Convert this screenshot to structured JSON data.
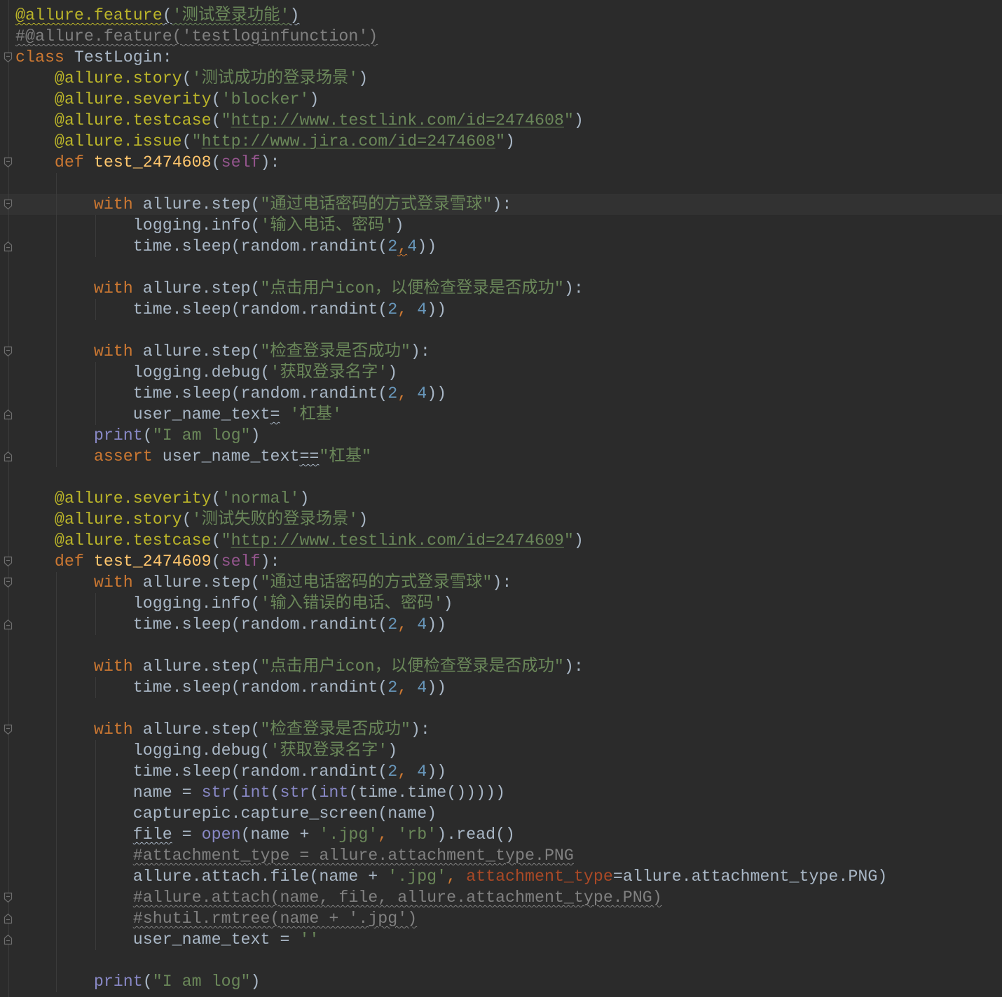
{
  "editor": {
    "language": "python",
    "current_line": 10
  },
  "colors": {
    "background": "#2b2b2b",
    "current_line": "#323232",
    "text": "#a9b7c6",
    "keyword": "#cc7832",
    "decorator": "#bbb529",
    "string": "#6a8759",
    "url": "#6a8759",
    "function": "#ffc66d",
    "self": "#94558d",
    "number": "#6897bb",
    "comment": "#808080",
    "builtin": "#8888c6",
    "param": "#aa4926",
    "indent_guide": "#3b3b3b",
    "fold_marker": "#6e6e6e"
  },
  "folds": [
    {
      "line": 3,
      "kind": "open"
    },
    {
      "line": 8,
      "kind": "open"
    },
    {
      "line": 10,
      "kind": "open"
    },
    {
      "line": 12,
      "kind": "close"
    },
    {
      "line": 17,
      "kind": "open"
    },
    {
      "line": 20,
      "kind": "close"
    },
    {
      "line": 22,
      "kind": "close"
    },
    {
      "line": 27,
      "kind": "open"
    },
    {
      "line": 28,
      "kind": "open"
    },
    {
      "line": 30,
      "kind": "close"
    },
    {
      "line": 35,
      "kind": "open"
    },
    {
      "line": 43,
      "kind": "open"
    },
    {
      "line": 44,
      "kind": "close"
    },
    {
      "line": 45,
      "kind": "close"
    }
  ],
  "icons": {
    "fold_open": "fold-open-icon",
    "fold_close": "fold-close-icon"
  },
  "lines": [
    [
      [
        "@allure.feature",
        "decorator",
        "wavy"
      ],
      [
        "(",
        "text",
        "wavy"
      ],
      [
        "'测试登录功能'",
        "string",
        "wavy"
      ],
      [
        ")",
        "text",
        "wavy"
      ]
    ],
    [
      [
        "#@allure.feature('testloginfunction')",
        "comment",
        "wavy"
      ]
    ],
    [
      [
        "class",
        "keyword"
      ],
      [
        " TestLogin:",
        "text"
      ]
    ],
    [
      [
        "    ",
        "text"
      ],
      [
        "@allure.story",
        "decorator"
      ],
      [
        "(",
        "text"
      ],
      [
        "'测试成功的登录场景'",
        "string"
      ],
      [
        ")",
        "text"
      ]
    ],
    [
      [
        "    ",
        "text"
      ],
      [
        "@allure.severity",
        "decorator"
      ],
      [
        "(",
        "text"
      ],
      [
        "'blocker'",
        "string"
      ],
      [
        ")",
        "text"
      ]
    ],
    [
      [
        "    ",
        "text"
      ],
      [
        "@allure.testcase",
        "decorator"
      ],
      [
        "(",
        "text"
      ],
      [
        "\"",
        "string"
      ],
      [
        "http://www.testlink.com/id=2474608",
        "url"
      ],
      [
        "\"",
        "string"
      ],
      [
        ")",
        "text"
      ]
    ],
    [
      [
        "    ",
        "text"
      ],
      [
        "@allure.issue",
        "decorator"
      ],
      [
        "(",
        "text"
      ],
      [
        "\"",
        "string"
      ],
      [
        "http://www.jira.com/id=2474608",
        "url"
      ],
      [
        "\"",
        "string"
      ],
      [
        ")",
        "text"
      ]
    ],
    [
      [
        "    ",
        "text"
      ],
      [
        "def",
        "keyword"
      ],
      [
        " ",
        "text"
      ],
      [
        "test_2474608",
        "function"
      ],
      [
        "(",
        "text"
      ],
      [
        "self",
        "self"
      ],
      [
        "):",
        "text"
      ]
    ],
    [],
    [
      [
        "        ",
        "text"
      ],
      [
        "with",
        "keyword"
      ],
      [
        " allure.step(",
        "text"
      ],
      [
        "\"通过电话密码的方式登录雪球\"",
        "string"
      ],
      [
        "):",
        "text"
      ]
    ],
    [
      [
        "            logging.info(",
        "text"
      ],
      [
        "'输入电话、密码'",
        "string"
      ],
      [
        ")",
        "text"
      ]
    ],
    [
      [
        "            time.sleep(random.randint(",
        "text"
      ],
      [
        "2",
        "number"
      ],
      [
        ",",
        "keyword",
        "wavy"
      ],
      [
        "4",
        "number"
      ],
      [
        "))",
        "text"
      ]
    ],
    [],
    [
      [
        "        ",
        "text"
      ],
      [
        "with",
        "keyword"
      ],
      [
        " allure.step(",
        "text"
      ],
      [
        "\"点击用户icon，以便检查登录是否成功\"",
        "string"
      ],
      [
        "):",
        "text"
      ]
    ],
    [
      [
        "            time.sleep(random.randint(",
        "text"
      ],
      [
        "2",
        "number"
      ],
      [
        ", ",
        "keyword"
      ],
      [
        "4",
        "number"
      ],
      [
        "))",
        "text"
      ]
    ],
    [],
    [
      [
        "        ",
        "text"
      ],
      [
        "with",
        "keyword"
      ],
      [
        " allure.step(",
        "text"
      ],
      [
        "\"检查登录是否成功\"",
        "string"
      ],
      [
        "):",
        "text"
      ]
    ],
    [
      [
        "            logging.debug(",
        "text"
      ],
      [
        "'获取登录名字'",
        "string"
      ],
      [
        ")",
        "text"
      ]
    ],
    [
      [
        "            time.sleep(random.randint(",
        "text"
      ],
      [
        "2",
        "number"
      ],
      [
        ", ",
        "keyword"
      ],
      [
        "4",
        "number"
      ],
      [
        "))",
        "text"
      ]
    ],
    [
      [
        "            user_name_text",
        "text"
      ],
      [
        "=",
        "text",
        "wavy"
      ],
      [
        " ",
        "text"
      ],
      [
        "'杠基'",
        "string"
      ]
    ],
    [
      [
        "        ",
        "text"
      ],
      [
        "print",
        "builtin"
      ],
      [
        "(",
        "text"
      ],
      [
        "\"I am log\"",
        "string"
      ],
      [
        ")",
        "text"
      ]
    ],
    [
      [
        "        ",
        "text"
      ],
      [
        "assert",
        "keyword"
      ],
      [
        " user_name_text",
        "text"
      ],
      [
        "==",
        "text",
        "wavy"
      ],
      [
        "\"杠基\"",
        "string"
      ]
    ],
    [],
    [
      [
        "    ",
        "text"
      ],
      [
        "@allure.severity",
        "decorator"
      ],
      [
        "(",
        "text"
      ],
      [
        "'normal'",
        "string"
      ],
      [
        ")",
        "text"
      ]
    ],
    [
      [
        "    ",
        "text"
      ],
      [
        "@allure.story",
        "decorator"
      ],
      [
        "(",
        "text"
      ],
      [
        "'测试失败的登录场景'",
        "string"
      ],
      [
        ")",
        "text"
      ]
    ],
    [
      [
        "    ",
        "text"
      ],
      [
        "@allure.testcase",
        "decorator"
      ],
      [
        "(",
        "text"
      ],
      [
        "\"",
        "string"
      ],
      [
        "http://www.testlink.com/id=2474609",
        "url"
      ],
      [
        "\"",
        "string"
      ],
      [
        ")",
        "text"
      ]
    ],
    [
      [
        "    ",
        "text"
      ],
      [
        "def",
        "keyword"
      ],
      [
        " ",
        "text"
      ],
      [
        "test_2474609",
        "function"
      ],
      [
        "(",
        "text"
      ],
      [
        "self",
        "self"
      ],
      [
        "):",
        "text"
      ]
    ],
    [
      [
        "        ",
        "text"
      ],
      [
        "with",
        "keyword"
      ],
      [
        " allure.step(",
        "text"
      ],
      [
        "\"通过电话密码的方式登录雪球\"",
        "string"
      ],
      [
        "):",
        "text"
      ]
    ],
    [
      [
        "            logging.info(",
        "text"
      ],
      [
        "'输入错误的电话、密码'",
        "string"
      ],
      [
        ")",
        "text"
      ]
    ],
    [
      [
        "            time.sleep(random.randint(",
        "text"
      ],
      [
        "2",
        "number"
      ],
      [
        ", ",
        "keyword"
      ],
      [
        "4",
        "number"
      ],
      [
        "))",
        "text"
      ]
    ],
    [],
    [
      [
        "        ",
        "text"
      ],
      [
        "with",
        "keyword"
      ],
      [
        " allure.step(",
        "text"
      ],
      [
        "\"点击用户icon，以便检查登录是否成功\"",
        "string"
      ],
      [
        "):",
        "text"
      ]
    ],
    [
      [
        "            time.sleep(random.randint(",
        "text"
      ],
      [
        "2",
        "number"
      ],
      [
        ", ",
        "keyword"
      ],
      [
        "4",
        "number"
      ],
      [
        "))",
        "text"
      ]
    ],
    [],
    [
      [
        "        ",
        "text"
      ],
      [
        "with",
        "keyword"
      ],
      [
        " allure.step(",
        "text"
      ],
      [
        "\"检查登录是否成功\"",
        "string"
      ],
      [
        "):",
        "text"
      ]
    ],
    [
      [
        "            logging.debug(",
        "text"
      ],
      [
        "'获取登录名字'",
        "string"
      ],
      [
        ")",
        "text"
      ]
    ],
    [
      [
        "            time.sleep(random.randint(",
        "text"
      ],
      [
        "2",
        "number"
      ],
      [
        ", ",
        "keyword"
      ],
      [
        "4",
        "number"
      ],
      [
        "))",
        "text"
      ]
    ],
    [
      [
        "            name = ",
        "text"
      ],
      [
        "str",
        "builtin"
      ],
      [
        "(",
        "text"
      ],
      [
        "int",
        "builtin"
      ],
      [
        "(",
        "text"
      ],
      [
        "str",
        "builtin"
      ],
      [
        "(",
        "text"
      ],
      [
        "int",
        "builtin"
      ],
      [
        "(time.time()))))",
        "text"
      ]
    ],
    [
      [
        "            capturepic.capture_screen(name)",
        "text"
      ]
    ],
    [
      [
        "            ",
        "text"
      ],
      [
        "file",
        "text",
        "wavy"
      ],
      [
        " = ",
        "text"
      ],
      [
        "open",
        "builtin"
      ],
      [
        "(name + ",
        "text"
      ],
      [
        "'.jpg'",
        "string"
      ],
      [
        ", ",
        "keyword"
      ],
      [
        "'rb'",
        "string"
      ],
      [
        ").read()",
        "text"
      ]
    ],
    [
      [
        "            ",
        "text"
      ],
      [
        "#attachment_type = allure.attachment_type.PNG",
        "comment",
        "wavy"
      ]
    ],
    [
      [
        "            allure.attach.file(name + ",
        "text"
      ],
      [
        "'.jpg'",
        "string"
      ],
      [
        ", ",
        "keyword"
      ],
      [
        "attachment_type",
        "param"
      ],
      [
        "=allure.attachment_type.PNG)",
        "text"
      ]
    ],
    [
      [
        "            ",
        "text"
      ],
      [
        "#allure.attach(name, file, allure.attachment_type.PNG)",
        "comment",
        "wavy"
      ]
    ],
    [
      [
        "            ",
        "text"
      ],
      [
        "#shutil.rmtree(name + '.jpg')",
        "comment",
        "wavy"
      ]
    ],
    [
      [
        "            user_name_text = ",
        "text"
      ],
      [
        "''",
        "string"
      ]
    ],
    [],
    [
      [
        "        ",
        "text"
      ],
      [
        "print",
        "builtin"
      ],
      [
        "(",
        "text"
      ],
      [
        "\"I am log\"",
        "string"
      ],
      [
        ")",
        "text"
      ]
    ]
  ]
}
